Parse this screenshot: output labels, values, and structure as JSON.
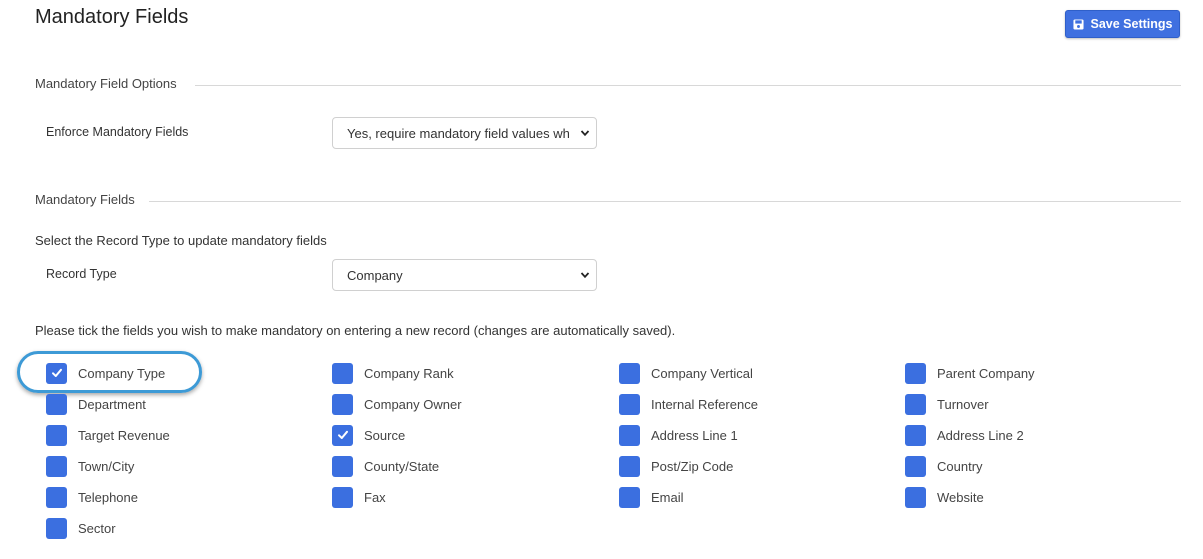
{
  "page": {
    "title": "Mandatory Fields",
    "save_label": "Save Settings",
    "accent_color": "#3b6fe0"
  },
  "options_section": {
    "heading": "Mandatory Field Options",
    "enforce_label": "Enforce Mandatory Fields",
    "enforce_value": "Yes, require mandatory field values when entering a new record"
  },
  "fields_section": {
    "heading": "Mandatory Fields",
    "instruction": "Select the Record Type to update mandatory fields",
    "record_type_label": "Record Type",
    "record_type_value": "Company",
    "tick_instruction": "Please tick the fields you wish to make mandatory on entering a new record (changes are automatically saved)."
  },
  "fields": [
    {
      "label": "Company Type",
      "checked": true
    },
    {
      "label": "Company Rank",
      "checked": false
    },
    {
      "label": "Company Vertical",
      "checked": false
    },
    {
      "label": "Parent Company",
      "checked": false
    },
    {
      "label": "Department",
      "checked": false
    },
    {
      "label": "Company Owner",
      "checked": false
    },
    {
      "label": "Internal Reference",
      "checked": false
    },
    {
      "label": "Turnover",
      "checked": false
    },
    {
      "label": "Target Revenue",
      "checked": false
    },
    {
      "label": "Source",
      "checked": true
    },
    {
      "label": "Address Line 1",
      "checked": false
    },
    {
      "label": "Address Line 2",
      "checked": false
    },
    {
      "label": "Town/City",
      "checked": false
    },
    {
      "label": "County/State",
      "checked": false
    },
    {
      "label": "Post/Zip Code",
      "checked": false
    },
    {
      "label": "Country",
      "checked": false
    },
    {
      "label": "Telephone",
      "checked": false
    },
    {
      "label": "Fax",
      "checked": false
    },
    {
      "label": "Email",
      "checked": false
    },
    {
      "label": "Website",
      "checked": false
    },
    {
      "label": "Sector",
      "checked": false
    }
  ]
}
